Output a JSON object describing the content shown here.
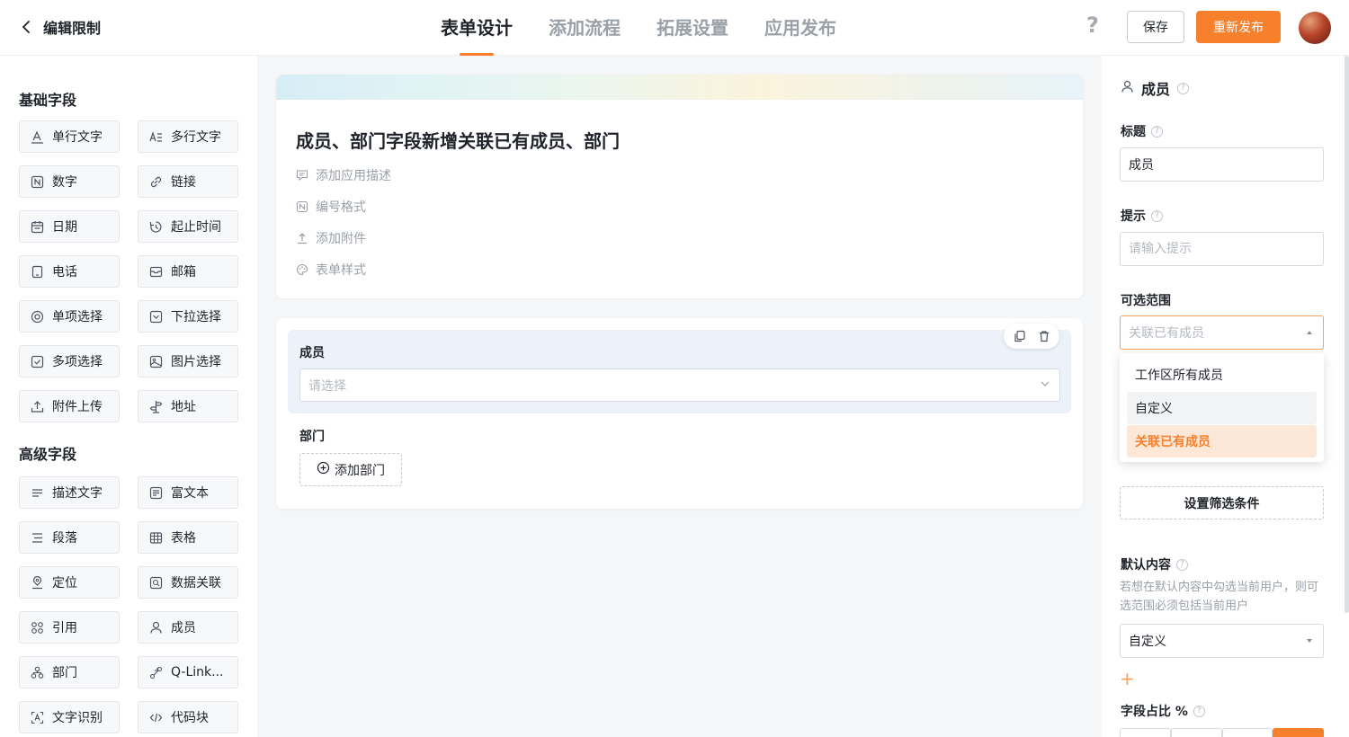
{
  "header": {
    "back_label": "编辑限制",
    "tabs": [
      {
        "label": "表单设计",
        "active": true
      },
      {
        "label": "添加流程",
        "active": false
      },
      {
        "label": "拓展设置",
        "active": false
      },
      {
        "label": "应用发布",
        "active": false
      }
    ],
    "help_label": "?",
    "save_label": "保存",
    "publish_label": "重新发布"
  },
  "palette": {
    "basic_title": "基础字段",
    "advanced_title": "高级字段",
    "basic": [
      {
        "label": "单行文字",
        "icon": "text-a-icon"
      },
      {
        "label": "多行文字",
        "icon": "multiline-text-icon"
      },
      {
        "label": "数字",
        "icon": "number-icon"
      },
      {
        "label": "链接",
        "icon": "link-icon"
      },
      {
        "label": "日期",
        "icon": "calendar-icon"
      },
      {
        "label": "起止时间",
        "icon": "time-range-icon"
      },
      {
        "label": "电话",
        "icon": "phone-icon"
      },
      {
        "label": "邮箱",
        "icon": "mail-icon"
      },
      {
        "label": "单项选择",
        "icon": "radio-icon"
      },
      {
        "label": "下拉选择",
        "icon": "dropdown-icon"
      },
      {
        "label": "多项选择",
        "icon": "checkbox-icon"
      },
      {
        "label": "图片选择",
        "icon": "image-icon"
      },
      {
        "label": "附件上传",
        "icon": "upload-icon"
      },
      {
        "label": "地址",
        "icon": "signpost-icon"
      }
    ],
    "advanced": [
      {
        "label": "描述文字",
        "icon": "description-icon"
      },
      {
        "label": "富文本",
        "icon": "rich-text-icon"
      },
      {
        "label": "段落",
        "icon": "paragraph-icon"
      },
      {
        "label": "表格",
        "icon": "table-icon"
      },
      {
        "label": "定位",
        "icon": "location-icon"
      },
      {
        "label": "数据关联",
        "icon": "data-link-icon"
      },
      {
        "label": "引用",
        "icon": "reference-icon"
      },
      {
        "label": "成员",
        "icon": "user-icon"
      },
      {
        "label": "部门",
        "icon": "org-icon"
      },
      {
        "label": "Q-Link...",
        "icon": "qlink-icon"
      },
      {
        "label": "文字识别",
        "icon": "ocr-icon"
      },
      {
        "label": "代码块",
        "icon": "code-icon"
      }
    ]
  },
  "form": {
    "title": "成员、部门字段新增关联已有成员、部门",
    "options": [
      {
        "label": "添加应用描述",
        "icon": "comment-icon"
      },
      {
        "label": "编号格式",
        "icon": "number-format-icon"
      },
      {
        "label": "添加附件",
        "icon": "upload-icon"
      },
      {
        "label": "表单样式",
        "icon": "palette-icon"
      }
    ],
    "member_field": {
      "label": "成员",
      "placeholder": "请选择"
    },
    "dept_field": {
      "label": "部门",
      "add_label": "添加部门"
    }
  },
  "props": {
    "heading": "成员",
    "title_label": "标题",
    "title_value": "成员",
    "hint_label": "提示",
    "hint_placeholder": "请输入提示",
    "range_label": "可选范围",
    "range_value": "关联已有成员",
    "range_options": [
      {
        "label": "工作区所有成员",
        "state": "normal"
      },
      {
        "label": "自定义",
        "state": "hover"
      },
      {
        "label": "关联已有成员",
        "state": "selected"
      }
    ],
    "filter_button": "设置筛选条件",
    "default_label": "默认内容",
    "default_hint": "若想在默认内容中勾选当前用户，则可选范围必须包括当前用户",
    "default_value": "自定义",
    "ratio_label": "字段占比 %"
  },
  "colors": {
    "accent": "#f7802d",
    "selected_bg": "#fde8d8",
    "field_block_bg": "#edf1fa"
  }
}
